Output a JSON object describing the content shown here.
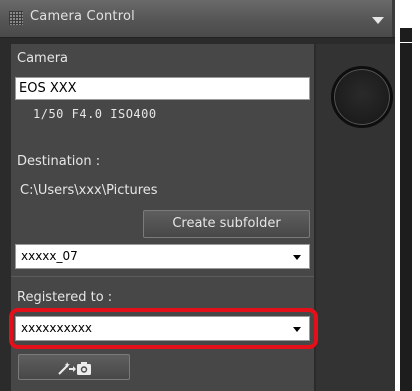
{
  "window": {
    "title": "Camera Control"
  },
  "camera": {
    "section_label": "Camera",
    "model": "EOS XXX",
    "settings": "1/50  F4.0  ISO400"
  },
  "destination": {
    "label": "Destination :",
    "path": "C:\\Users\\xxx\\Pictures",
    "create_subfolder_label": "Create subfolder",
    "subfolder_value": "xxxxx_07"
  },
  "registered": {
    "label": "Registered to :",
    "value": "xxxxxxxxxx"
  },
  "colors": {
    "highlight": "#e3101a",
    "panel_bg": "#474747"
  },
  "icons": {
    "title_grip": "grip-icon",
    "title_menu": "dropdown-arrow-icon",
    "capture": "wand-to-camera-icon"
  }
}
